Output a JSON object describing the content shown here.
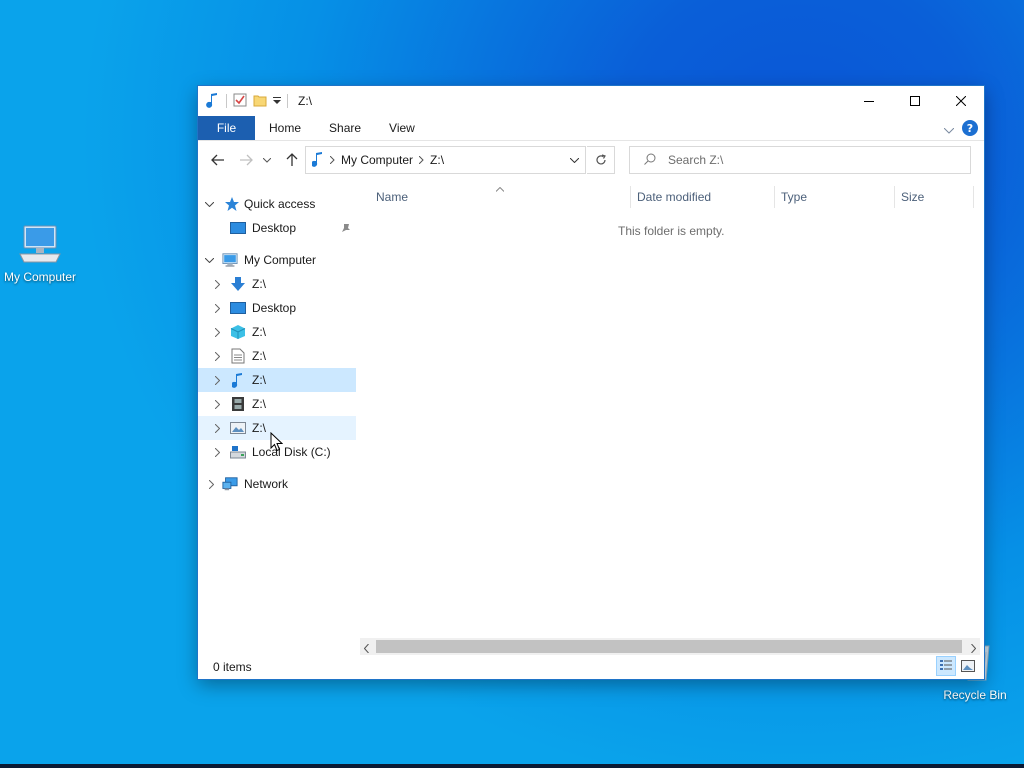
{
  "desktop": {
    "icons": [
      {
        "label": "My Computer"
      },
      {
        "label": "Recycle Bin"
      }
    ]
  },
  "window": {
    "title": "Z:\\",
    "ribbon": {
      "tabs": [
        "File",
        "Home",
        "Share",
        "View"
      ]
    },
    "address": {
      "crumbs": [
        "My Computer",
        "Z:\\"
      ]
    },
    "search": {
      "placeholder": "Search Z:\\"
    },
    "nav": {
      "quick_access": "Quick access",
      "qa_desktop": "Desktop",
      "my_computer": "My Computer",
      "items": [
        "Z:\\",
        "Desktop",
        "Z:\\",
        "Z:\\",
        "Z:\\",
        "Z:\\",
        "Z:\\",
        "Local Disk (C:)"
      ],
      "network": "Network"
    },
    "columns": [
      "Name",
      "Date modified",
      "Type",
      "Size"
    ],
    "empty_message": "This folder is empty.",
    "status": "0 items"
  },
  "colors": {
    "accent": "#1c5fb0",
    "selection": "#cce8ff",
    "hover": "#e5f3ff",
    "desktop": "#0874de"
  },
  "icons": [
    "music-icon",
    "properties-icon",
    "folder-icon",
    "back-arrow-icon",
    "forward-arrow-icon",
    "up-arrow-icon",
    "refresh-icon",
    "search-icon",
    "star-icon",
    "pin-icon",
    "monitor-icon",
    "downloads-icon",
    "3d-objects-icon",
    "documents-icon",
    "videos-icon",
    "pictures-icon",
    "drive-icon",
    "network-icon",
    "help-icon",
    "recycle-bin-icon"
  ]
}
